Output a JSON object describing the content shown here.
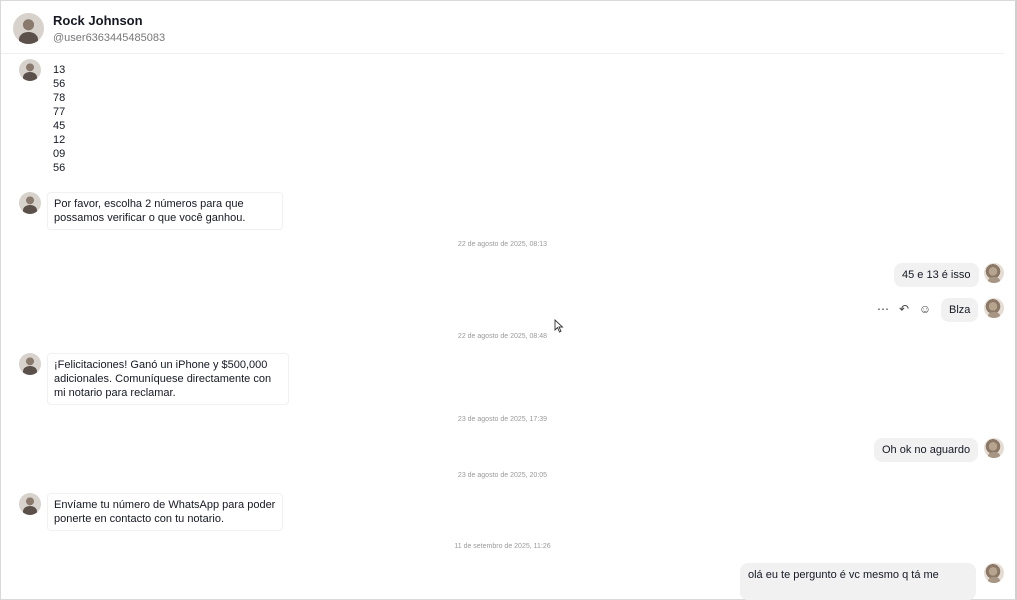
{
  "contact": {
    "name": "Rock Johnson",
    "handle": "@user6363445485083"
  },
  "messages": {
    "m1_lines": [
      "13",
      "56",
      "78",
      "77",
      "45",
      "12",
      "09",
      "56"
    ],
    "m2": [
      "Por favor, escolha 2 números para que",
      "possamos verificar o que você ganhou."
    ],
    "ts1": "22 de agosto de 2025, 08:13",
    "m3": "45 e 13 é isso",
    "m4": "Blza",
    "ts2": "22 de agosto de 2025, 08:48",
    "m5": [
      "¡Felicitaciones! Ganó un iPhone y $500,000",
      "adicionales. Comuníquese directamente con",
      "mi notario para reclamar."
    ],
    "ts3": "23 de agosto de 2025, 17:39",
    "m6": "Oh ok no aguardo",
    "ts4": "23 de agosto de 2025, 20:05",
    "m7": [
      "Envíame tu número de WhatsApp para poder",
      "ponerte en contacto con tu notario."
    ],
    "ts5": "11 de setembro de 2025, 11:26",
    "m8": "olá eu te pergunto é vc mesmo q tá me"
  },
  "icons": {
    "more": "more-icon",
    "reply": "reply-icon",
    "emoji": "emoji-icon"
  }
}
